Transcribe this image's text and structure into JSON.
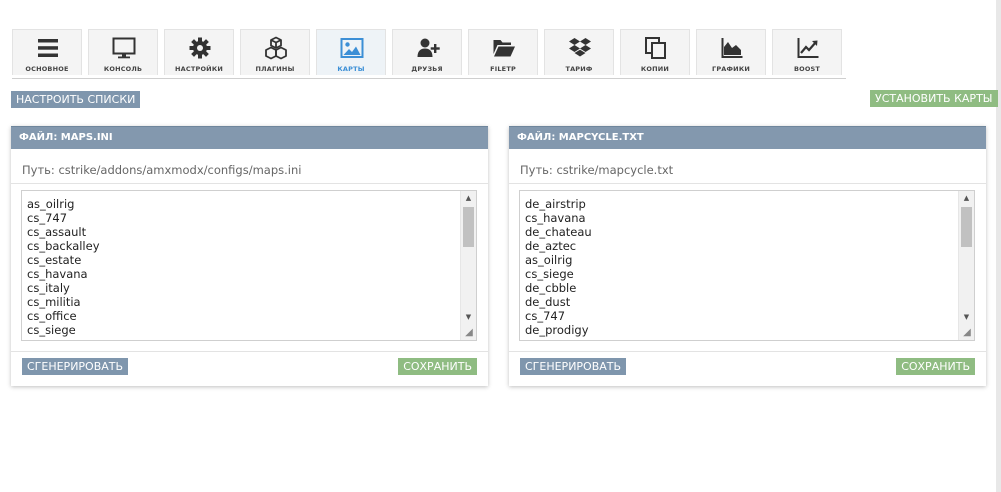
{
  "toolbar": {
    "items": [
      {
        "label": "ОСНОВНОЕ",
        "icon": "menu-icon",
        "active": false
      },
      {
        "label": "КОНСОЛЬ",
        "icon": "monitor-icon",
        "active": false
      },
      {
        "label": "НАСТРОЙКИ",
        "icon": "gear-icon",
        "active": false
      },
      {
        "label": "ПЛАГИНЫ",
        "icon": "cubes-icon",
        "active": false
      },
      {
        "label": "КАРТЫ",
        "icon": "image-icon",
        "active": true
      },
      {
        "label": "ДРУЗЬЯ",
        "icon": "user-plus-icon",
        "active": false
      },
      {
        "label": "FILETP",
        "icon": "folder-open-icon",
        "active": false
      },
      {
        "label": "ТАРИФ",
        "icon": "dropbox-icon",
        "active": false
      },
      {
        "label": "КОПИИ",
        "icon": "copy-icon",
        "active": false
      },
      {
        "label": "ГРАФИКИ",
        "icon": "area-chart-icon",
        "active": false
      },
      {
        "label": "BOOST",
        "icon": "line-chart-icon",
        "active": false
      }
    ]
  },
  "actions": {
    "configure_lists": "НАСТРОИТЬ СПИСКИ",
    "install_maps": "УСТАНОВИТЬ КАРТЫ"
  },
  "panels": [
    {
      "title": "ФАЙЛ: MAPS.INI",
      "path": "Путь: cstrike/addons/amxmodx/configs/maps.ini",
      "lines": [
        "as_oilrig",
        "cs_747",
        "cs_assault",
        "cs_backalley",
        "cs_estate",
        "cs_havana",
        "cs_italy",
        "cs_militia",
        "cs_office",
        "cs_siege"
      ],
      "generate": "СГЕНЕРИРОВАТЬ",
      "save": "СОХРАНИТЬ"
    },
    {
      "title": "ФАЙЛ: MAPCYCLE.TXT",
      "path": "Путь: cstrike/mapcycle.txt",
      "lines": [
        "de_airstrip",
        "cs_havana",
        "de_chateau",
        "de_aztec",
        "as_oilrig",
        "cs_siege",
        "de_cbble",
        "de_dust",
        "cs_747",
        "de_prodigy"
      ],
      "generate": "СГЕНЕРИРОВАТЬ",
      "save": "СОХРАНИТЬ"
    }
  ],
  "colors": {
    "accent_blue": "#3c8fd6",
    "panel_header": "#8398ae",
    "button_blue": "#7f96ad",
    "button_green": "#8fbc82"
  }
}
